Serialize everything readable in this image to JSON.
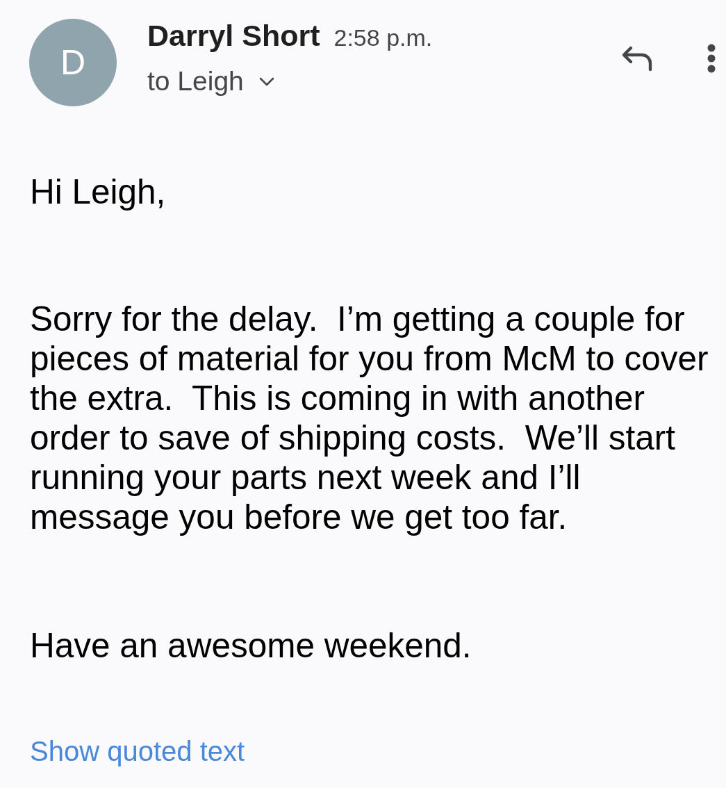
{
  "sender": {
    "avatar_letter": "D",
    "name": "Darryl Short",
    "time": "2:58 p.m.",
    "recipient": "to Leigh"
  },
  "body": {
    "greeting": "Hi Leigh,",
    "paragraphs": [
      "Sorry for the delay.  I’m getting a couple for pieces of material for you from McM to cover the extra.  This is coming in with another order to save of shipping costs.  We’ll start running your parts next week and I’ll message you before we get too far.",
      "Have an awesome weekend."
    ]
  },
  "show_quoted_text": "Show quoted text"
}
